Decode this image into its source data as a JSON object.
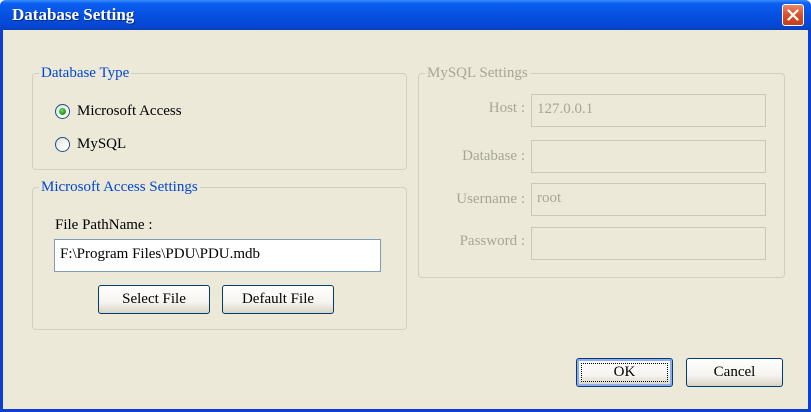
{
  "window": {
    "title": "Database Setting"
  },
  "database_type": {
    "legend": "Database Type",
    "options": [
      {
        "label": "Microsoft Access",
        "selected": true
      },
      {
        "label": "MySQL",
        "selected": false
      }
    ]
  },
  "access_settings": {
    "legend": "Microsoft Access Settings",
    "file_label": "File PathName :",
    "file_value": "F:\\Program Files\\PDU\\PDU.mdb",
    "select_file_label": "Select File",
    "default_file_label": "Default File"
  },
  "mysql_settings": {
    "legend": "MySQL Settings",
    "host_label": "Host :",
    "host_value": "127.0.0.1",
    "database_label": "Database :",
    "database_value": "",
    "username_label": "Username :",
    "username_value": "root",
    "password_label": "Password :",
    "password_value": ""
  },
  "buttons": {
    "ok_label": "OK",
    "cancel_label": "Cancel"
  },
  "colors": {
    "title_bar": "#0651e0",
    "group_label": "#0046d5",
    "disabled_text": "#a7a694",
    "close_button": "#d8502a"
  },
  "icons": {
    "close": "close-icon"
  }
}
